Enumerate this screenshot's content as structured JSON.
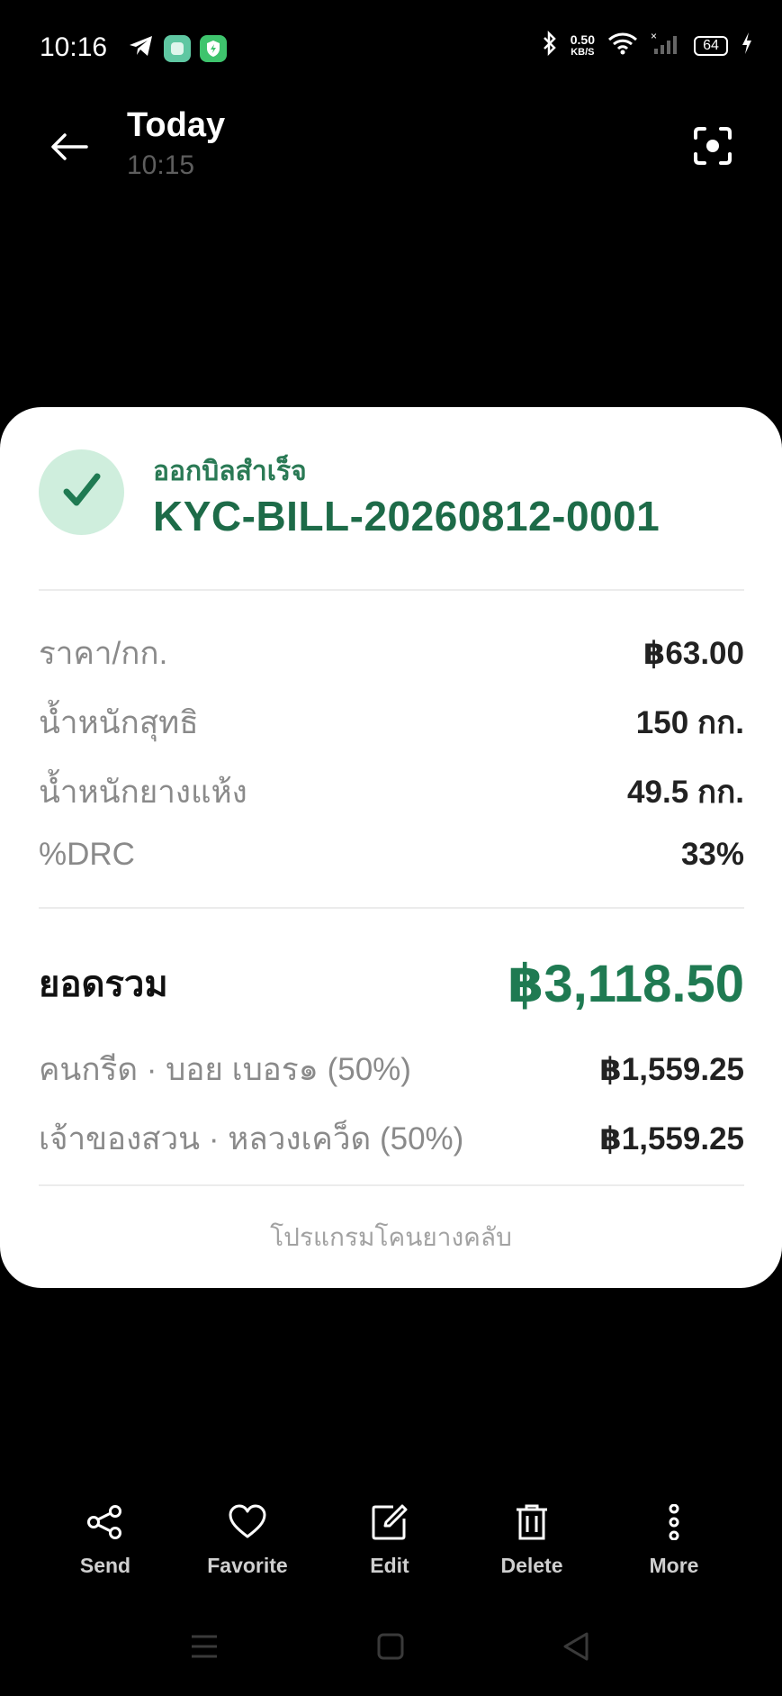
{
  "status_bar": {
    "time": "10:16",
    "net_speed_value": "0.50",
    "net_speed_unit": "KB/S",
    "battery": "64",
    "icons": [
      "telegram-icon",
      "app-icon",
      "shield-app-icon",
      "bluetooth-icon",
      "wifi-icon",
      "signal-icon",
      "charging-icon"
    ]
  },
  "header": {
    "title": "Today",
    "subtitle": "10:15"
  },
  "bill": {
    "status": "ออกบิลสำเร็จ",
    "bill_id": "KYC-BILL-20260812-0001",
    "details": [
      {
        "label": "ราคา/กก.",
        "value": "฿63.00"
      },
      {
        "label": "น้ำหนักสุทธิ",
        "value": "150 กก."
      },
      {
        "label": "น้ำหนักยางแห้ง",
        "value": "49.5 กก."
      },
      {
        "label": "%DRC",
        "value": "33%"
      }
    ],
    "total_label": "ยอดรวม",
    "total_value": "฿3,118.50",
    "splits": [
      {
        "label": "คนกรีด · บอย เบอร๑ (50%)",
        "value": "฿1,559.25"
      },
      {
        "label": "เจ้าของสวน · หลวงเคว็ด (50%)",
        "value": "฿1,559.25"
      }
    ],
    "footer": "โปรแกรมโคนยางคลับ",
    "accent_color": "#1f7a52"
  },
  "toolbar": {
    "items": [
      {
        "label": "Send",
        "icon": "share-icon"
      },
      {
        "label": "Favorite",
        "icon": "heart-icon"
      },
      {
        "label": "Edit",
        "icon": "edit-icon"
      },
      {
        "label": "Delete",
        "icon": "trash-icon"
      },
      {
        "label": "More",
        "icon": "more-vertical-icon"
      }
    ]
  }
}
